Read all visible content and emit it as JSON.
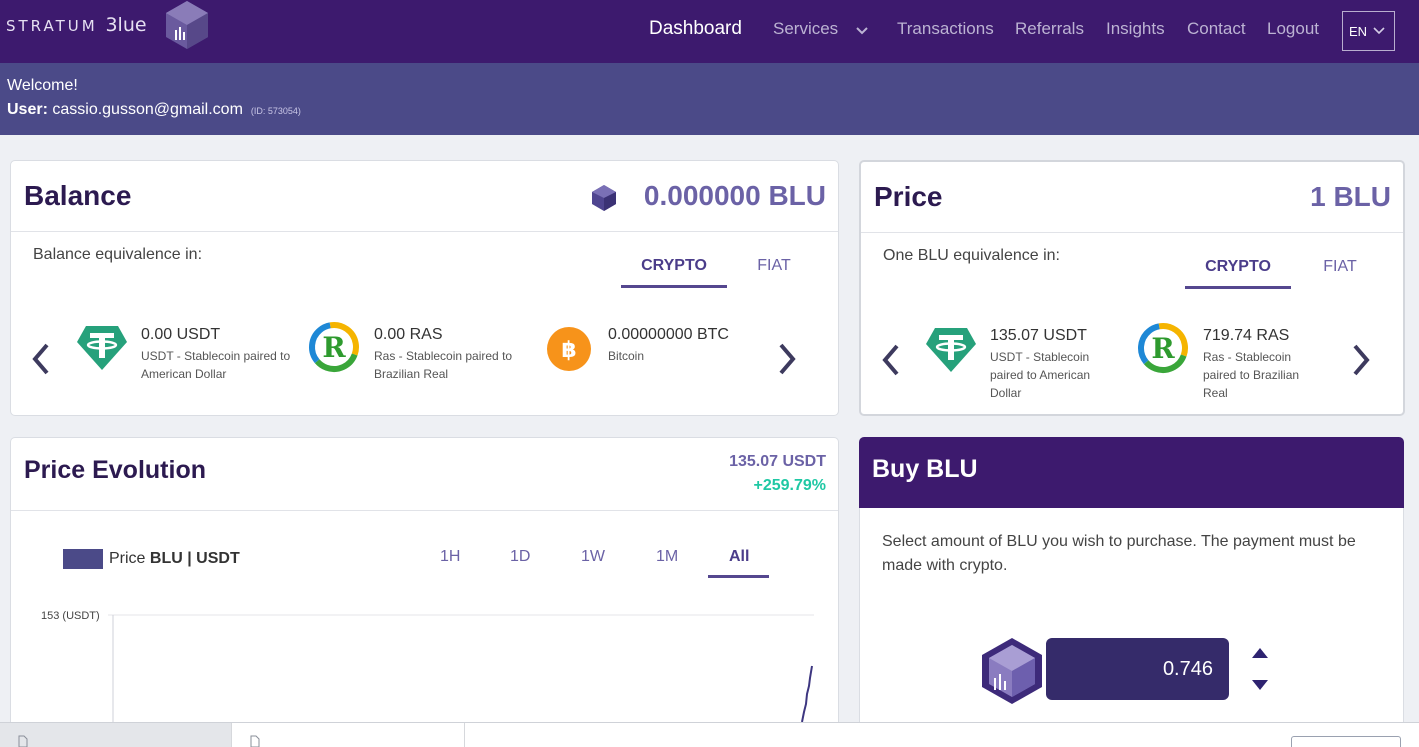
{
  "brand": {
    "name_prefix": "STRATUM",
    "name_suffix": "3lue"
  },
  "nav": {
    "items": [
      "Dashboard",
      "Services",
      "Transactions",
      "Referrals",
      "Insights",
      "Contact",
      "Logout"
    ],
    "active": "Dashboard",
    "language": "EN"
  },
  "welcome": {
    "greeting": "Welcome!",
    "user_label": "User:",
    "email": "cassio.gusson@gmail.com",
    "id_text": "(ID: 573054)"
  },
  "balance": {
    "title": "Balance",
    "value": "0.000000 BLU",
    "equivalence_label": "Balance equivalence in:",
    "tabs": [
      "CRYPTO",
      "FIAT"
    ],
    "active_tab": "CRYPTO",
    "coins": [
      {
        "icon": "tether-icon",
        "amount": "0.00 USDT",
        "desc": "USDT - Stablecoin paired to American Dollar"
      },
      {
        "icon": "ras-icon",
        "amount": "0.00 RAS",
        "desc": "Ras - Stablecoin paired to Brazilian Real"
      },
      {
        "icon": "bitcoin-icon",
        "amount": "0.00000000 BTC",
        "desc": "Bitcoin"
      }
    ]
  },
  "price": {
    "title": "Price",
    "value": "1 BLU",
    "equivalence_label": "One BLU equivalence in:",
    "tabs": [
      "CRYPTO",
      "FIAT"
    ],
    "active_tab": "CRYPTO",
    "coins": [
      {
        "icon": "tether-icon",
        "amount": "135.07 USDT",
        "desc": "USDT - Stablecoin paired to American Dollar"
      },
      {
        "icon": "ras-icon",
        "amount": "719.74 RAS",
        "desc": "Ras - Stablecoin paired to Brazilian Real"
      }
    ]
  },
  "evolution": {
    "title": "Price Evolution",
    "current": "135.07 USDT",
    "change": "+259.79%",
    "legend_prefix": "Price",
    "legend_pair": "BLU | USDT",
    "ranges": [
      "1H",
      "1D",
      "1W",
      "1M",
      "All"
    ],
    "active_range": "All",
    "y_top_label": "153 (USDT)"
  },
  "buy": {
    "title": "Buy BLU",
    "instructions": "Select amount of BLU you wish to purchase. The payment must be made with crypto.",
    "amount": "0.746"
  },
  "colors": {
    "nav_bg": "#3d1a6e",
    "welcome_bg": "#4b4a88",
    "accent": "#6b62a6",
    "positive": "#1fc8a4",
    "tether": "#26a17b",
    "bitcoin": "#f7931a"
  }
}
